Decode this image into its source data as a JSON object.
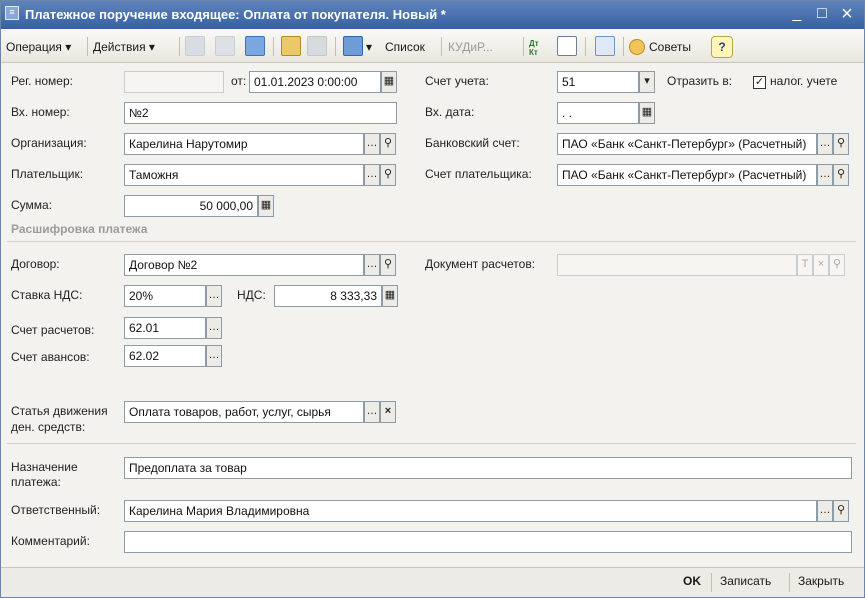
{
  "window": {
    "title": "Платежное поручение входящее: Оплата от покупателя. Новый *",
    "minimize": "_",
    "maximize": "□",
    "close": "×"
  },
  "toolbar": {
    "operation": "Операция",
    "actions": "Действия",
    "list": "Список",
    "kudir": "КУДиР...",
    "advice": "Советы",
    "help": "?",
    "dtkt": "Дт Кт"
  },
  "form": {
    "reg_number": {
      "label": "Рег. номер:",
      "value": ""
    },
    "date_from": {
      "label": "от:",
      "value": "01.01.2023  0:00:00"
    },
    "in_number": {
      "label": "Вх. номер:",
      "value": "№2"
    },
    "organization": {
      "label": "Организация:",
      "value": "Карелина Нарутомир"
    },
    "payer": {
      "label": "Плательщик:",
      "value": "Таможня"
    },
    "amount": {
      "label": "Сумма:",
      "value": "50 000,00"
    },
    "account": {
      "label": "Счет учета:",
      "value": "51"
    },
    "reflect_in": {
      "label": "Отразить в:",
      "checkbox_label": "налог. учете",
      "checked": true
    },
    "in_date": {
      "label": "Вх. дата:",
      "value": " .  ."
    },
    "bank_account": {
      "label": "Банковский счет:",
      "value": "ПАО «Банк «Санкт-Петербург» (Расчетный)"
    },
    "payer_account": {
      "label": "Счет плательщика:",
      "value": "ПАО «Банк «Санкт-Петербург» (Расчетный)"
    }
  },
  "breakdown": {
    "section_title": "Расшифровка платежа",
    "contract": {
      "label": "Договор:",
      "value": "Договор №2"
    },
    "settlement_doc": {
      "label": "Документ расчетов:",
      "value": ""
    },
    "vat_rate": {
      "label": "Ставка НДС:",
      "value": "20%"
    },
    "vat": {
      "label": "НДС:",
      "value": "8 333,33"
    },
    "settlement_account": {
      "label": "Счет расчетов:",
      "value": "62.01"
    },
    "advance_account": {
      "label": "Счет авансов:",
      "value": "62.02"
    },
    "cash_flow_item": {
      "label_line1": "Статья движения",
      "label_line2": "ден. средств:",
      "value": "Оплата товаров, работ, услуг, сырья"
    }
  },
  "bottom": {
    "purpose": {
      "label_line1": "Назначение",
      "label_line2": "платежа:",
      "value": "Предоплата за товар"
    },
    "responsible": {
      "label": "Ответственный:",
      "value": "Карелина Мария Владимировна"
    },
    "comment": {
      "label": "Комментарий:",
      "value": ""
    }
  },
  "footer": {
    "ok": "OK",
    "save": "Записать",
    "close": "Закрыть"
  },
  "colors": {
    "title_bar": "#36609f",
    "window_bg": "#f3f2ee",
    "section_title": "#9b9b9b"
  }
}
